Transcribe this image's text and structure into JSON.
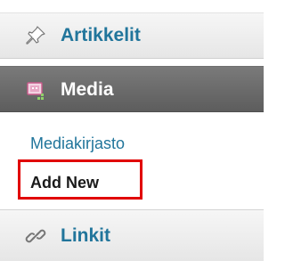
{
  "menu": {
    "articles": {
      "label": "Artikkelit",
      "icon": "pin-icon"
    },
    "media": {
      "label": "Media",
      "icon": "media-icon"
    },
    "media_submenu": [
      {
        "label": "Mediakirjasto"
      },
      {
        "label": "Add New"
      }
    ],
    "links": {
      "label": "Linkit",
      "icon": "link-icon"
    }
  },
  "colors": {
    "link_blue": "#21759b",
    "active_bg": "#666666",
    "highlight_red": "#e10000"
  }
}
